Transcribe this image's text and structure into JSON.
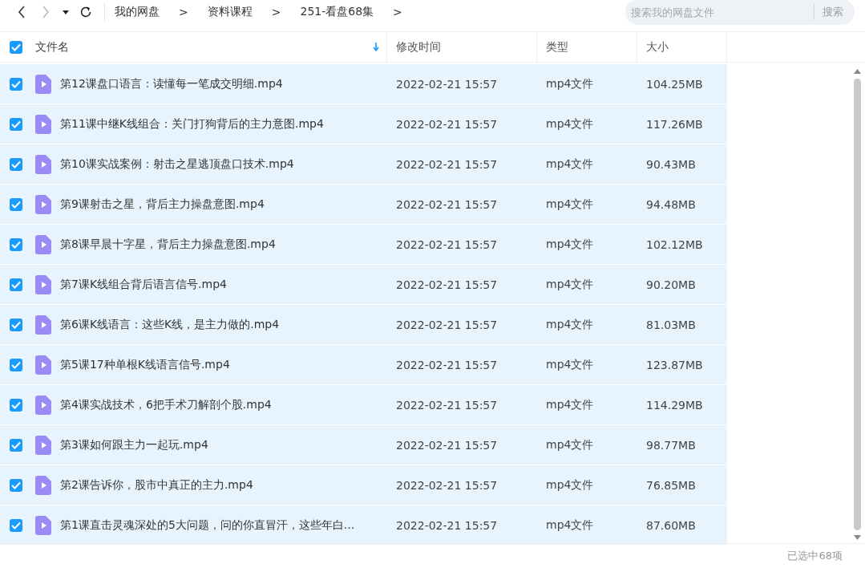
{
  "toolbar": {
    "breadcrumbs": [
      "我的网盘",
      "资料课程",
      "251-看盘68集"
    ],
    "separators": [
      ">",
      ">",
      ">"
    ],
    "search": {
      "placeholder": "搜索我的网盘文件",
      "button": "搜索"
    }
  },
  "table": {
    "all_checked": true,
    "columns": [
      {
        "label": "文件名",
        "sorted": true
      },
      {
        "label": "修改时间",
        "sorted": false
      },
      {
        "label": "类型",
        "sorted": false
      },
      {
        "label": "大小",
        "sorted": false
      }
    ],
    "rows": [
      {
        "checked": true,
        "name": "第12课盘口语言：读懂每一笔成交明细.mp4",
        "modified": "2022-02-21 15:57",
        "type": "mp4文件",
        "size": "104.25MB"
      },
      {
        "checked": true,
        "name": "第11课中继K线组合：关门打狗背后的主力意图.mp4",
        "modified": "2022-02-21 15:57",
        "type": "mp4文件",
        "size": "117.26MB"
      },
      {
        "checked": true,
        "name": "第10课实战案例：射击之星逃顶盘口技术.mp4",
        "modified": "2022-02-21 15:57",
        "type": "mp4文件",
        "size": "90.43MB"
      },
      {
        "checked": true,
        "name": "第9课射击之星，背后主力操盘意图.mp4",
        "modified": "2022-02-21 15:57",
        "type": "mp4文件",
        "size": "94.48MB"
      },
      {
        "checked": true,
        "name": "第8课早晨十字星，背后主力操盘意图.mp4",
        "modified": "2022-02-21 15:57",
        "type": "mp4文件",
        "size": "102.12MB"
      },
      {
        "checked": true,
        "name": "第7课K线组合背后语言信号.mp4",
        "modified": "2022-02-21 15:57",
        "type": "mp4文件",
        "size": "90.20MB"
      },
      {
        "checked": true,
        "name": "第6课K线语言：这些K线，是主力做的.mp4",
        "modified": "2022-02-21 15:57",
        "type": "mp4文件",
        "size": "81.03MB"
      },
      {
        "checked": true,
        "name": "第5课17种单根K线语言信号.mp4",
        "modified": "2022-02-21 15:57",
        "type": "mp4文件",
        "size": "123.87MB"
      },
      {
        "checked": true,
        "name": "第4课实战技术，6把手术刀解剖个股.mp4",
        "modified": "2022-02-21 15:57",
        "type": "mp4文件",
        "size": "114.29MB"
      },
      {
        "checked": true,
        "name": "第3课如何跟主力一起玩.mp4",
        "modified": "2022-02-21 15:57",
        "type": "mp4文件",
        "size": "98.77MB"
      },
      {
        "checked": true,
        "name": "第2课告诉你，股市中真正的主力.mp4",
        "modified": "2022-02-21 15:57",
        "type": "mp4文件",
        "size": "76.85MB"
      },
      {
        "checked": true,
        "name": "第1课直击灵魂深处的5大问题，问的你直冒汗，这些年白...",
        "modified": "2022-02-21 15:57",
        "type": "mp4文件",
        "size": "87.60MB"
      }
    ]
  },
  "status_bar": {
    "selection": "已选中68项"
  }
}
